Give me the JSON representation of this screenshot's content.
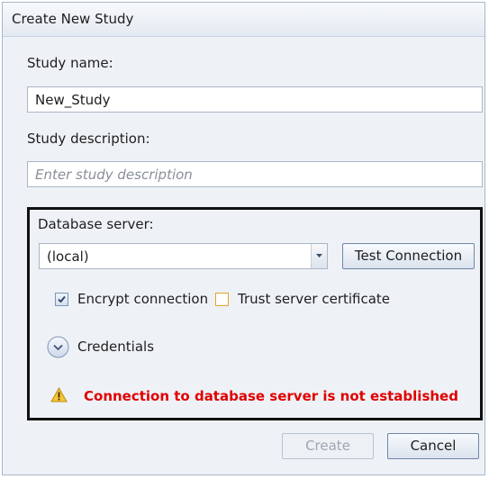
{
  "dialog": {
    "title": "Create New Study"
  },
  "study_name": {
    "label": "Study name:",
    "value": "New_Study"
  },
  "study_description": {
    "label": "Study description:",
    "placeholder": "Enter study description"
  },
  "database": {
    "label": "Database server:",
    "server_value": "(local)",
    "test_button": "Test Connection",
    "encrypt_label": "Encrypt connection",
    "encrypt_checked": true,
    "trust_label": "Trust server certificate",
    "trust_checked": false,
    "credentials_label": "Credentials",
    "status_message": "Connection to database server  is not established",
    "status_color": "#e00000",
    "warning_icon": "warning-icon"
  },
  "footer": {
    "create_label": "Create",
    "create_enabled": false,
    "cancel_label": "Cancel"
  }
}
